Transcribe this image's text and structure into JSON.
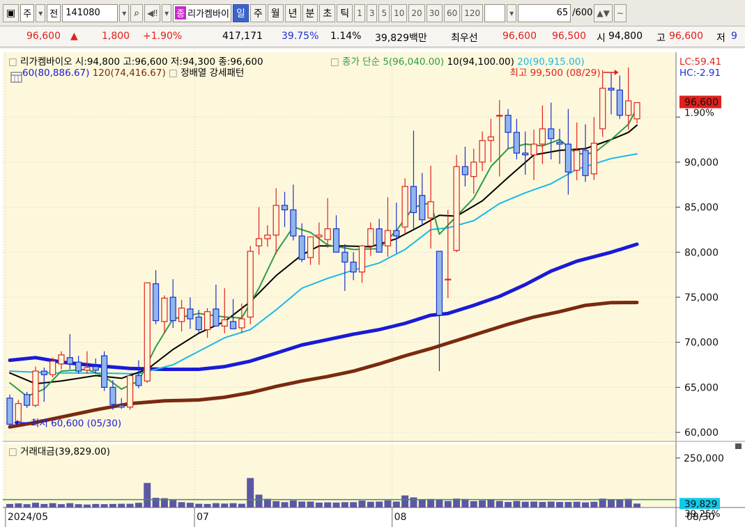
{
  "toolbar": {
    "period_label": "주",
    "all_label": "전",
    "stock_code": "141080",
    "stock_tag": "종",
    "stock_name": "리가켐바이",
    "periods": [
      "일",
      "주",
      "월",
      "년",
      "분",
      "초",
      "틱"
    ],
    "minute_options": [
      "1",
      "3",
      "5",
      "10",
      "20",
      "30",
      "60",
      "120"
    ],
    "bar_count": "65",
    "bar_total": "/600"
  },
  "quote": {
    "price": "96,600",
    "change_arrow": "▲",
    "change": "1,800",
    "change_pct": "+1.90%",
    "volume": "417,171",
    "turnover_rate": "39.75%",
    "vol_ratio": "1.14%",
    "amount": "39,829백만",
    "best_label": "최우선",
    "ask": "96,600",
    "bid": "96,500",
    "open_label": "시",
    "open": "94,800",
    "high_label": "고",
    "high": "96,600",
    "low_label": "저",
    "low": "9"
  },
  "chart_data": {
    "type": "candlestick",
    "title": "리가켐바이오 시:94,800 고:96,600 저:94,300 종:96,600",
    "ma_legend_prefix": "종가 단순",
    "ma_labels": [
      "5(96,040.00)",
      "10(94,100.00)",
      "20(90,915.00)",
      "60(80,886.67)",
      "120(74,416.67)"
    ],
    "ma_colors": [
      "#2e9a44",
      "#000000",
      "#19b8e8",
      "#1a1ad6",
      "#7a2a0f"
    ],
    "pattern_label": "정배열 강세패턴",
    "lc_label": "LC:59.41",
    "hc_label": "HC:-2.91",
    "current_price_label": "96,600",
    "current_change_label": "1.90%",
    "max_annotation": "최고 99,500 (08/29)",
    "min_annotation": "최저 60,600 (05/30)",
    "ylim": [
      59000,
      102200
    ],
    "yticks": [
      60000,
      65000,
      70000,
      75000,
      80000,
      85000,
      90000,
      95000
    ],
    "ytick_labels": [
      "60,000",
      "65,000",
      "70,000",
      "75,000",
      "80,000",
      "85,000",
      "90,000"
    ],
    "x_labels": [
      {
        "index": 0,
        "text": "2024/05"
      },
      {
        "index": 22,
        "text": "07"
      },
      {
        "index": 45,
        "text": "08"
      }
    ],
    "last_date_label": "08/30",
    "candles": [
      [
        63800,
        64200,
        60600,
        60900
      ],
      [
        61200,
        63600,
        61000,
        63200
      ],
      [
        64200,
        64500,
        62700,
        63000
      ],
      [
        63000,
        67300,
        62800,
        66800
      ],
      [
        66800,
        67200,
        63400,
        66400
      ],
      [
        66400,
        68300,
        66100,
        67900
      ],
      [
        67600,
        69000,
        67000,
        68600
      ],
      [
        68300,
        70900,
        67000,
        67600
      ],
      [
        67800,
        68500,
        66500,
        66800
      ],
      [
        66900,
        69000,
        66500,
        67200
      ],
      [
        67300,
        68200,
        66500,
        66900
      ],
      [
        68500,
        69000,
        64600,
        65000
      ],
      [
        65000,
        65800,
        62500,
        63100
      ],
      [
        63000,
        63800,
        62600,
        62800
      ],
      [
        62800,
        66300,
        62500,
        66300
      ],
      [
        66300,
        68000,
        64900,
        65200
      ],
      [
        65700,
        70800,
        65500,
        76600
      ],
      [
        76500,
        78000,
        72000,
        72400
      ],
      [
        72300,
        75200,
        71000,
        74900
      ],
      [
        75000,
        77000,
        71600,
        72400
      ],
      [
        72300,
        74700,
        71200,
        73800
      ],
      [
        73700,
        75000,
        71500,
        72600
      ],
      [
        72800,
        73600,
        71000,
        71400
      ],
      [
        71400,
        73800,
        70500,
        73400
      ],
      [
        73700,
        76400,
        72000,
        71800
      ],
      [
        71800,
        76000,
        71000,
        72500
      ],
      [
        72300,
        74800,
        71900,
        71500
      ],
      [
        71600,
        74300,
        71000,
        72600
      ],
      [
        72800,
        80700,
        72000,
        80100
      ],
      [
        80700,
        85000,
        79700,
        81500
      ],
      [
        81500,
        83000,
        80600,
        81900
      ],
      [
        81900,
        87100,
        79800,
        85200
      ],
      [
        85200,
        86700,
        82800,
        84700
      ],
      [
        84700,
        87500,
        81300,
        81800
      ],
      [
        81800,
        83200,
        78900,
        79200
      ],
      [
        79400,
        81400,
        78600,
        81700
      ],
      [
        81700,
        83300,
        78600,
        81900
      ],
      [
        81400,
        86000,
        80500,
        82600
      ],
      [
        82600,
        84100,
        81700,
        80000
      ],
      [
        80000,
        80900,
        75700,
        78900
      ],
      [
        78900,
        80000,
        76900,
        77800
      ],
      [
        77800,
        80800,
        76600,
        80700
      ],
      [
        80700,
        83300,
        79600,
        82600
      ],
      [
        82600,
        83700,
        80000,
        80000
      ],
      [
        80700,
        86100,
        79500,
        82400
      ],
      [
        82400,
        85500,
        79900,
        81800
      ],
      [
        82800,
        88200,
        82000,
        87300
      ],
      [
        87300,
        93500,
        82600,
        84400
      ],
      [
        86300,
        88800,
        83000,
        83600
      ],
      [
        83800,
        89600,
        80400,
        85600
      ],
      [
        80100,
        80100,
        66800,
        73000
      ],
      [
        77000,
        84700,
        74900,
        77000
      ],
      [
        80200,
        90800,
        80000,
        89500
      ],
      [
        89500,
        91700,
        87300,
        88600
      ],
      [
        88400,
        91500,
        86500,
        90000
      ],
      [
        90000,
        93400,
        89000,
        92400
      ],
      [
        92400,
        94800,
        90000,
        92800
      ],
      [
        95100,
        96900,
        88400,
        95200
      ],
      [
        95200,
        95900,
        91500,
        93300
      ],
      [
        93300,
        94800,
        90300,
        91000
      ],
      [
        91000,
        93400,
        88600,
        90800
      ],
      [
        90800,
        93600,
        88000,
        92000
      ],
      [
        92000,
        96300,
        89800,
        93700
      ],
      [
        93700,
        96600,
        90300,
        92600
      ],
      [
        92200,
        93700,
        89800,
        92000
      ],
      [
        92000,
        95900,
        86400,
        88900
      ],
      [
        89100,
        94400,
        88000,
        91300
      ],
      [
        91300,
        94200,
        87800,
        88500
      ],
      [
        88700,
        95000,
        88000,
        92100
      ],
      [
        93700,
        100200,
        92800,
        98200
      ],
      [
        98200,
        100000,
        95300,
        98000
      ],
      [
        98000,
        99600,
        94800,
        95200
      ],
      [
        95200,
        100500,
        93600,
        96800
      ],
      [
        94800,
        96600,
        94300,
        96600
      ]
    ],
    "ma_series": {
      "ma5": [
        [
          0,
          65500
        ],
        [
          2,
          64000
        ],
        [
          4,
          64800
        ],
        [
          6,
          66800
        ],
        [
          9,
          67000
        ],
        [
          11,
          66200
        ],
        [
          13,
          64800
        ],
        [
          15,
          65700
        ],
        [
          17,
          69500
        ],
        [
          19,
          72600
        ],
        [
          22,
          73200
        ],
        [
          25,
          72800
        ],
        [
          27,
          72700
        ],
        [
          29,
          76000
        ],
        [
          31,
          80000
        ],
        [
          33,
          82800
        ],
        [
          35,
          82200
        ],
        [
          37,
          80800
        ],
        [
          40,
          80300
        ],
        [
          43,
          80400
        ],
        [
          45,
          82400
        ],
        [
          47,
          85000
        ],
        [
          49,
          85500
        ],
        [
          50,
          82000
        ],
        [
          52,
          84000
        ],
        [
          54,
          86000
        ],
        [
          56,
          89500
        ],
        [
          58,
          91500
        ],
        [
          60,
          92000
        ],
        [
          62,
          91800
        ],
        [
          64,
          92500
        ],
        [
          66,
          90900
        ],
        [
          68,
          91000
        ],
        [
          70,
          92500
        ],
        [
          72,
          94200
        ],
        [
          73,
          96040
        ]
      ],
      "ma10": [
        [
          0,
          66600
        ],
        [
          3,
          65400
        ],
        [
          6,
          65700
        ],
        [
          10,
          66300
        ],
        [
          13,
          66000
        ],
        [
          16,
          67000
        ],
        [
          19,
          69200
        ],
        [
          22,
          71000
        ],
        [
          25,
          72300
        ],
        [
          28,
          74500
        ],
        [
          31,
          77400
        ],
        [
          34,
          79700
        ],
        [
          36,
          80700
        ],
        [
          39,
          80700
        ],
        [
          42,
          80600
        ],
        [
          45,
          81500
        ],
        [
          48,
          83000
        ],
        [
          50,
          84100
        ],
        [
          52,
          84000
        ],
        [
          55,
          85700
        ],
        [
          58,
          88300
        ],
        [
          61,
          90800
        ],
        [
          64,
          91300
        ],
        [
          67,
          91500
        ],
        [
          70,
          92500
        ],
        [
          72,
          93300
        ],
        [
          73,
          94100
        ]
      ],
      "ma20": [
        [
          0,
          66800
        ],
        [
          5,
          66600
        ],
        [
          10,
          66600
        ],
        [
          15,
          66500
        ],
        [
          19,
          67500
        ],
        [
          22,
          69000
        ],
        [
          25,
          70500
        ],
        [
          28,
          71400
        ],
        [
          31,
          73600
        ],
        [
          34,
          76000
        ],
        [
          37,
          77100
        ],
        [
          40,
          78000
        ],
        [
          43,
          78800
        ],
        [
          46,
          80300
        ],
        [
          49,
          82500
        ],
        [
          51,
          82700
        ],
        [
          54,
          83500
        ],
        [
          57,
          85400
        ],
        [
          60,
          86600
        ],
        [
          63,
          87600
        ],
        [
          66,
          89200
        ],
        [
          70,
          90400
        ],
        [
          73,
          90915
        ]
      ],
      "ma60": [
        [
          0,
          68000
        ],
        [
          3,
          68300
        ],
        [
          6,
          67800
        ],
        [
          10,
          67400
        ],
        [
          14,
          67100
        ],
        [
          18,
          67000
        ],
        [
          22,
          67000
        ],
        [
          25,
          67300
        ],
        [
          28,
          67900
        ],
        [
          31,
          68800
        ],
        [
          34,
          69700
        ],
        [
          37,
          70300
        ],
        [
          40,
          70900
        ],
        [
          43,
          71400
        ],
        [
          46,
          72100
        ],
        [
          49,
          73000
        ],
        [
          51,
          73200
        ],
        [
          54,
          74100
        ],
        [
          57,
          75100
        ],
        [
          60,
          76400
        ],
        [
          63,
          77900
        ],
        [
          66,
          79000
        ],
        [
          70,
          80000
        ],
        [
          73,
          80887
        ]
      ],
      "ma120": [
        [
          0,
          60600
        ],
        [
          3,
          61100
        ],
        [
          6,
          61700
        ],
        [
          10,
          62500
        ],
        [
          14,
          63200
        ],
        [
          18,
          63500
        ],
        [
          22,
          63600
        ],
        [
          25,
          63900
        ],
        [
          28,
          64400
        ],
        [
          31,
          65100
        ],
        [
          34,
          65700
        ],
        [
          37,
          66200
        ],
        [
          40,
          66800
        ],
        [
          43,
          67600
        ],
        [
          46,
          68500
        ],
        [
          49,
          69300
        ],
        [
          52,
          70200
        ],
        [
          55,
          71100
        ],
        [
          58,
          72000
        ],
        [
          61,
          72800
        ],
        [
          64,
          73400
        ],
        [
          67,
          74100
        ],
        [
          70,
          74400
        ],
        [
          73,
          74417
        ]
      ]
    },
    "volume": {
      "title": "거래대금(39,829.00)",
      "ytick_label": "250,000",
      "last_value_label": "39,829",
      "last_pct_label": "39.25%",
      "ylim": [
        0,
        320000
      ],
      "reference_line": 40000,
      "values": [
        18000,
        21000,
        17000,
        24000,
        18000,
        22000,
        17000,
        22000,
        17000,
        15000,
        18000,
        17000,
        18000,
        19000,
        19000,
        24000,
        124000,
        49000,
        47000,
        37000,
        27000,
        24000,
        19000,
        18000,
        22000,
        20000,
        22000,
        19000,
        149000,
        65000,
        44000,
        32000,
        27000,
        36000,
        30000,
        30000,
        25000,
        26000,
        25000,
        27000,
        27000,
        35000,
        29000,
        30000,
        36000,
        30000,
        61000,
        51000,
        42000,
        43000,
        39000,
        33000,
        45000,
        43000,
        32000,
        36000,
        42000,
        33000,
        28000,
        33000,
        29000,
        30000,
        28000,
        30000,
        28000,
        28000,
        29000,
        26000,
        29000,
        45000,
        42000,
        39000,
        44000,
        20000
      ]
    }
  }
}
